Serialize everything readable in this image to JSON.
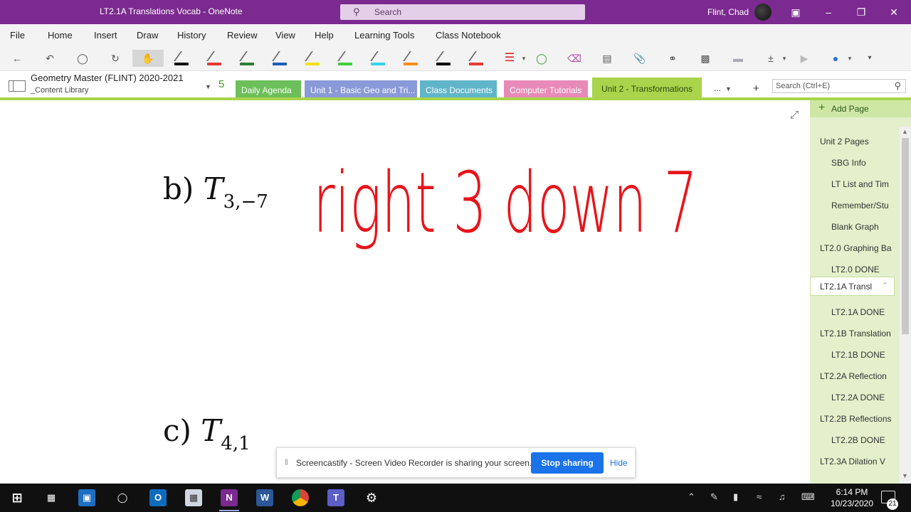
{
  "titlebar": {
    "title": "LT2.1A Translations Vocab  -  OneNote",
    "search_placeholder": "Search",
    "user": "Flint, Chad"
  },
  "menu": [
    "File",
    "Home",
    "Insert",
    "Draw",
    "History",
    "Review",
    "View",
    "Help",
    "Learning Tools",
    "Class Notebook"
  ],
  "toolbar": {
    "pen_colors": [
      "#111111",
      "#e53935",
      "#2e7d32",
      "#1e5bbd",
      "#f4e100",
      "#3dd13d",
      "#34d3e8",
      "#ff8a1e",
      "#000000",
      "#e53935"
    ]
  },
  "notebook": {
    "name": "Geometry Master (FLINT) 2020-2021",
    "section_group": "_Content Library",
    "section_count_glyph": "5"
  },
  "sections": [
    {
      "label": "Daily Agenda",
      "color": "#6cbf5a"
    },
    {
      "label": "Unit 1 - Basic Geo and Tri...",
      "color": "#8a9ad8"
    },
    {
      "label": "Class Documents",
      "color": "#60b5c9"
    },
    {
      "label": "Computer Tutorials",
      "color": "#e88ab8"
    },
    {
      "label": "Unit 2 - Transformations",
      "color": "#a9d44b"
    }
  ],
  "sections_more": "...",
  "search_notebook": "Search (Ctrl+E)",
  "canvas": {
    "b_label": "b)",
    "b_var": "T",
    "b_sub": "3,−7",
    "c_label": "c)",
    "c_var": "T",
    "c_sub": "4,1",
    "ink_text": "right 3 down 7",
    "ink_color": "#e8141a"
  },
  "pages": {
    "add_label": "Add Page",
    "items": [
      {
        "label": "Unit 2 Pages",
        "level": 0
      },
      {
        "label": "SBG Info",
        "level": 1
      },
      {
        "label": "LT List and Tim",
        "level": 1
      },
      {
        "label": "Remember/Stu",
        "level": 1
      },
      {
        "label": "Blank Graph",
        "level": 1
      },
      {
        "label": "LT2.0 Graphing Ba",
        "level": 0
      },
      {
        "label": "LT2.0 DONE",
        "level": 1
      },
      {
        "label": "LT2.1A Transl",
        "level": 0,
        "selected": true
      },
      {
        "label": "LT2.1A DONE",
        "level": 1
      },
      {
        "label": "LT2.1B Translation",
        "level": 0
      },
      {
        "label": "LT2.1B DONE",
        "level": 1
      },
      {
        "label": "LT2.2A Reflection",
        "level": 0
      },
      {
        "label": "LT2.2A DONE",
        "level": 1
      },
      {
        "label": "LT2.2B Reflections",
        "level": 0
      },
      {
        "label": "LT2.2B DONE",
        "level": 1
      },
      {
        "label": "LT2.3A Dilation V",
        "level": 0
      }
    ]
  },
  "share": {
    "message": "Screencastify - Screen Video Recorder is sharing your screen.",
    "stop_label": "Stop sharing",
    "hide_label": "Hide"
  },
  "taskbar": {
    "time": "6:14 PM",
    "date": "10/23/2020",
    "notification_count": "21"
  }
}
